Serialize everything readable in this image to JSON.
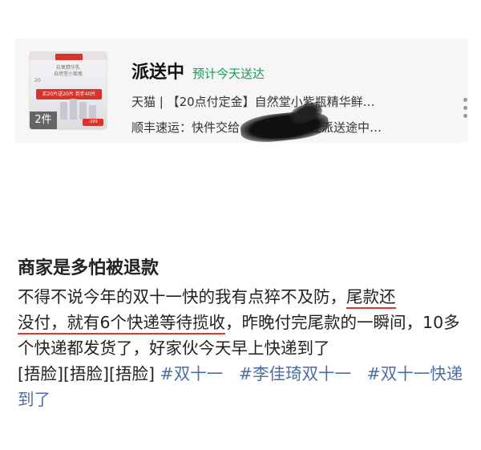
{
  "delivery": {
    "status": "派送中",
    "eta": "预计今天送达",
    "shop_line": "天猫 | 【20点付定金】自然堂小紫瓶精华鲜…",
    "courier_line_start": "顺丰速运：快件交给",
    "courier_line_end": "正在派送途中…",
    "thumbnail": {
      "quantity": "2件",
      "promo": "买20片送20片 到手40片",
      "price": "-299",
      "brand_line1": "抗氧精华乳",
      "brand_line2": "自然堂小紫瓶",
      "small_tag": "20"
    }
  },
  "post": {
    "title": "商家是多怕被退款",
    "body_part1": "不得不说今年的双十一快的我有点猝不及防，",
    "body_underlined1": "尾款还",
    "body_underlined2": "没付，就有6个快递等待揽收",
    "body_part2": "，昨晚付完尾款的一瞬间，10多个快递都发货了，好家伙今天早上快递到了",
    "emoji_text": "[捂脸][捂脸][捂脸]",
    "hashtags": [
      "#双十一",
      "#李佳琦双十一",
      "#双十一快递到了"
    ]
  },
  "colors": {
    "eta_green": "#1a9a55",
    "hashtag_blue": "#4a6fa5",
    "underline_red": "#e2362d"
  },
  "icons": {
    "more": "vertical-more-icon"
  }
}
